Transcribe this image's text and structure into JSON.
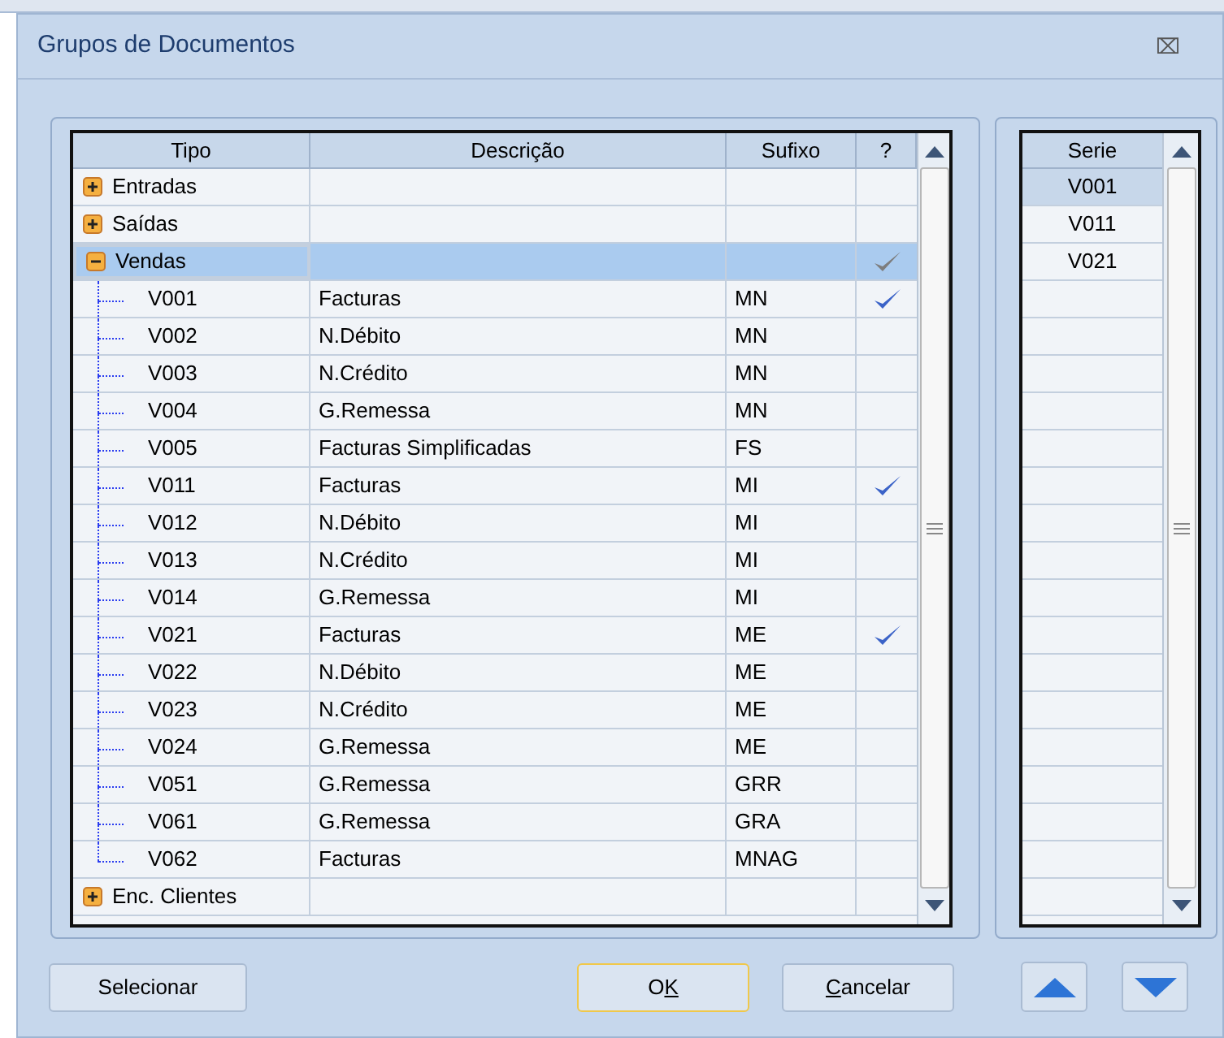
{
  "window": {
    "title": "Grupos de Documentos",
    "close": "⌧"
  },
  "table": {
    "columns": [
      "Tipo",
      "Descrição",
      "Sufixo",
      "?"
    ],
    "groups": [
      {
        "tipo": "Entradas",
        "expanded": false,
        "selected": false,
        "checked": false
      },
      {
        "tipo": "Saídas",
        "expanded": false,
        "selected": false,
        "checked": false
      },
      {
        "tipo": "Vendas",
        "expanded": true,
        "selected": true,
        "checked": true,
        "children": [
          {
            "tipo": "V001",
            "descricao": "Facturas",
            "sufixo": "MN",
            "checked": true
          },
          {
            "tipo": "V002",
            "descricao": "N.Débito",
            "sufixo": "MN",
            "checked": false
          },
          {
            "tipo": "V003",
            "descricao": "N.Crédito",
            "sufixo": "MN",
            "checked": false
          },
          {
            "tipo": "V004",
            "descricao": "G.Remessa",
            "sufixo": "MN",
            "checked": false
          },
          {
            "tipo": "V005",
            "descricao": "Facturas Simplificadas",
            "sufixo": "FS",
            "checked": false
          },
          {
            "tipo": "V011",
            "descricao": "Facturas",
            "sufixo": "MI",
            "checked": true
          },
          {
            "tipo": "V012",
            "descricao": "N.Débito",
            "sufixo": "MI",
            "checked": false
          },
          {
            "tipo": "V013",
            "descricao": "N.Crédito",
            "sufixo": "MI",
            "checked": false
          },
          {
            "tipo": "V014",
            "descricao": "G.Remessa",
            "sufixo": "MI",
            "checked": false
          },
          {
            "tipo": "V021",
            "descricao": "Facturas",
            "sufixo": "ME",
            "checked": true
          },
          {
            "tipo": "V022",
            "descricao": "N.Débito",
            "sufixo": "ME",
            "checked": false
          },
          {
            "tipo": "V023",
            "descricao": "N.Crédito",
            "sufixo": "ME",
            "checked": false
          },
          {
            "tipo": "V024",
            "descricao": "G.Remessa",
            "sufixo": "ME",
            "checked": false
          },
          {
            "tipo": "V051",
            "descricao": "G.Remessa",
            "sufixo": "GRR",
            "checked": false
          },
          {
            "tipo": "V061",
            "descricao": "G.Remessa",
            "sufixo": "GRA",
            "checked": false
          },
          {
            "tipo": "V062",
            "descricao": "Facturas",
            "sufixo": "MNAG",
            "checked": false
          }
        ]
      },
      {
        "tipo": "Enc. Clientes",
        "expanded": false,
        "selected": false,
        "checked": false
      }
    ]
  },
  "serie": {
    "column": "Serie",
    "items": [
      {
        "label": "V001",
        "selected": true
      },
      {
        "label": "V011",
        "selected": false
      },
      {
        "label": "V021",
        "selected": false
      }
    ]
  },
  "buttons": [
    {
      "kind": "plain",
      "before": "Selecionar",
      "default": false
    },
    {
      "kind": "plain",
      "before": "O",
      "mnemonic": "K",
      "default": true
    },
    {
      "kind": "plain",
      "mnemonic": "C",
      "after": "ancelar",
      "default": false
    }
  ]
}
